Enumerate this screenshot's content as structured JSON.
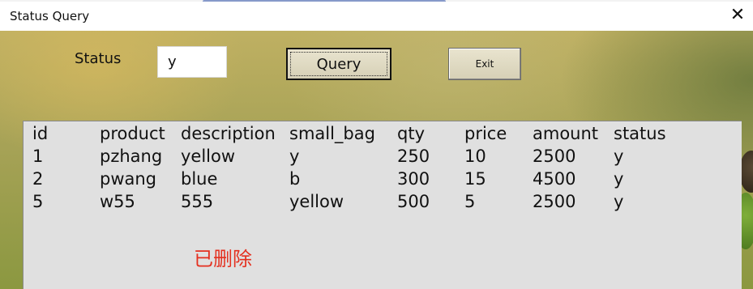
{
  "window": {
    "title": "Status Query"
  },
  "form": {
    "status_label": "Status",
    "status_value": "y",
    "query_label": "Query",
    "exit_label": "Exit"
  },
  "table": {
    "headers": [
      "id",
      "product",
      "description",
      "small_bag",
      "qty",
      "price",
      "amount",
      "status"
    ],
    "rows": [
      [
        "1",
        "pzhang",
        "yellow",
        "y",
        "250",
        "10",
        "2500",
        "y"
      ],
      [
        "2",
        "pwang",
        "blue",
        "b",
        "300",
        "15",
        "4500",
        "y"
      ],
      [
        "5",
        "w55",
        "555",
        "yellow",
        "500",
        "5",
        "2500",
        "y"
      ]
    ]
  },
  "message": "已删除",
  "colors": {
    "message": "#e4301f",
    "panel": "#e0e0e0"
  },
  "icons": {
    "close": "close-icon"
  }
}
